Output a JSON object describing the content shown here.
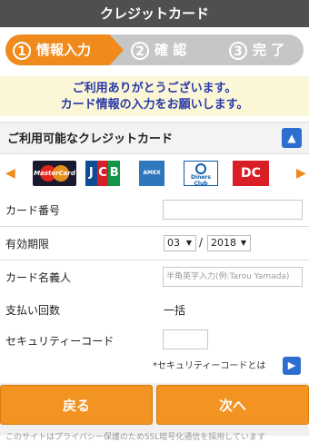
{
  "title": "クレジットカード",
  "steps": [
    {
      "num": "1",
      "label": "情報入力",
      "active": true
    },
    {
      "num": "2",
      "label": "確 認",
      "active": false
    },
    {
      "num": "3",
      "label": "完 了",
      "active": false
    }
  ],
  "notice": {
    "line1": "ご利用ありがとうございます。",
    "line2": "カード情報の入力をお願いします。"
  },
  "cards": {
    "heading": "ご利用可能なクレジットカード",
    "collapse_icon": "chevron-up-icon",
    "prev_icon": "arrow-left-icon",
    "next_icon": "arrow-right-icon",
    "logos": {
      "mastercard": "MasterCard",
      "jcb": [
        "J",
        "C",
        "B"
      ],
      "amex": "AMEX",
      "diners": "Diners Club",
      "dc": "DC"
    }
  },
  "form": {
    "card_number_label": "カード番号",
    "card_number_value": "",
    "expiry_label": "有効期限",
    "expiry_month": "03",
    "expiry_separator": "/",
    "expiry_year": "2018",
    "holder_label": "カード名義人",
    "holder_placeholder": "半角英字入力(例:Tarou Yamada)",
    "installments_label": "支払い回数",
    "installments_value": "一括",
    "security_label": "セキュリティーコード",
    "security_value": "",
    "security_note": "*セキュリティーコードとは"
  },
  "buttons": {
    "back": "戻る",
    "next": "次へ"
  },
  "footer_text": "このサイトはプライバシー保護のためSSL暗号化通信を採用しています",
  "colors": {
    "titlebar": "#4f4f4f",
    "accent_orange": "#f08a1c",
    "inactive_step": "#c6c6c6",
    "notice_bg": "#fbf6d6",
    "notice_text": "#2a3aa8",
    "blue_button": "#2c6fd1"
  }
}
